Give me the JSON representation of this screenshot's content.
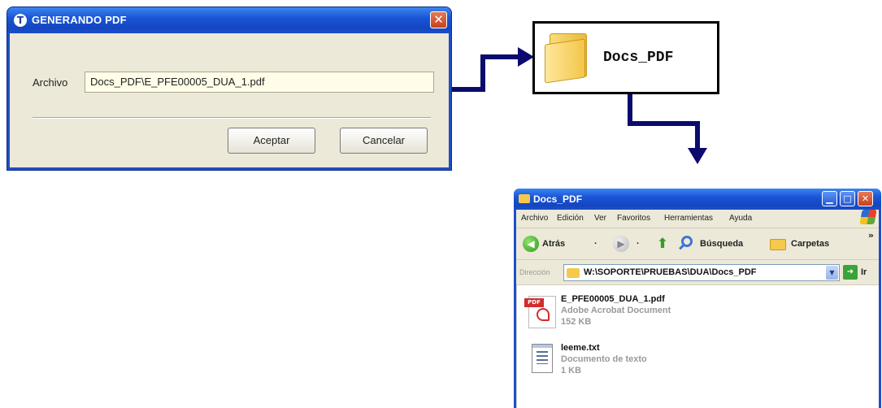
{
  "dialog": {
    "title": "GENERANDO PDF",
    "app_icon_glyph": "T",
    "close_glyph": "✕",
    "archivo_label": "Archivo",
    "archivo_value": "Docs_PDF\\E_PFE00005_DUA_1.pdf",
    "accept_label": "Aceptar",
    "cancel_label": "Cancelar"
  },
  "folder_callout": {
    "label": "Docs_PDF",
    "icon": "folder-icon"
  },
  "explorer": {
    "title": "Docs_PDF",
    "window_buttons": {
      "minimize": "▁",
      "maximize": "□",
      "close": "✕"
    },
    "menu": [
      "Archivo",
      "Edición",
      "Ver",
      "Favoritos",
      "Herramientas",
      "Ayuda"
    ],
    "toolbar": {
      "back_label": "Atrás",
      "back_glyph": "◀",
      "back_dropdown": "·",
      "forward_glyph": "▶",
      "forward_dropdown": "·",
      "up_glyph": "⬆",
      "search_label": "Búsqueda",
      "folders_label": "Carpetas",
      "more_glyph": "»"
    },
    "address": {
      "label": "Dirección",
      "value": "W:\\SOPORTE\\PRUEBAS\\DUA\\Docs_PDF",
      "dropdown_glyph": "▼",
      "go_glyph": "➜",
      "go_label": "Ir"
    },
    "files": [
      {
        "name": "E_PFE00005_DUA_1.pdf",
        "type": "Adobe Acrobat Document",
        "size": "152 KB",
        "icon": "pdf-file-icon",
        "tag": "PDF"
      },
      {
        "name": "leeme.txt",
        "type": "Documento de texto",
        "size": "1 KB",
        "icon": "text-file-icon"
      }
    ]
  },
  "colors": {
    "xp_title_blue": "#1f4fc4",
    "dialog_bg": "#ece9d8",
    "input_bg": "#fffde8",
    "arrow_navy": "#0b0b6e",
    "close_red": "#c5421c"
  }
}
